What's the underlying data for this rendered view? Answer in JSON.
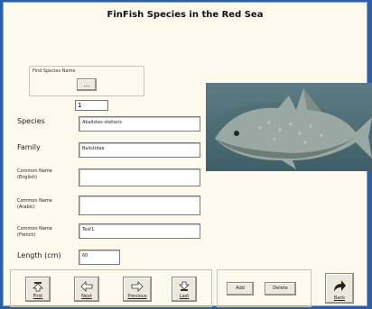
{
  "form": {
    "title": "FinFish Species in the Red Sea",
    "find_label": "Find Species Name",
    "find_button": "...",
    "record_number": "1"
  },
  "fields": {
    "species_label": "Species",
    "species_value": "Abalistes stellaris",
    "family_label": "Family",
    "family_value": "Balistidae",
    "cn_english_label": "Common Name\n(English)",
    "cn_english_value": "",
    "cn_arabic_label": "Common Name\n(Arabic)",
    "cn_arabic_value": "",
    "cn_french_label": "Common Name\n(French)",
    "cn_french_value": "Text1",
    "length_label": "Length (cm)",
    "length_value": "60"
  },
  "nav": {
    "first": "First",
    "next": "Next",
    "previous": "Previous",
    "last": "Last"
  },
  "actions": {
    "add": "Add",
    "delete": "Delete",
    "back": "Back"
  },
  "colors": {
    "window_bg": "#2b5fa8",
    "form_bg": "#fdf9ed"
  }
}
